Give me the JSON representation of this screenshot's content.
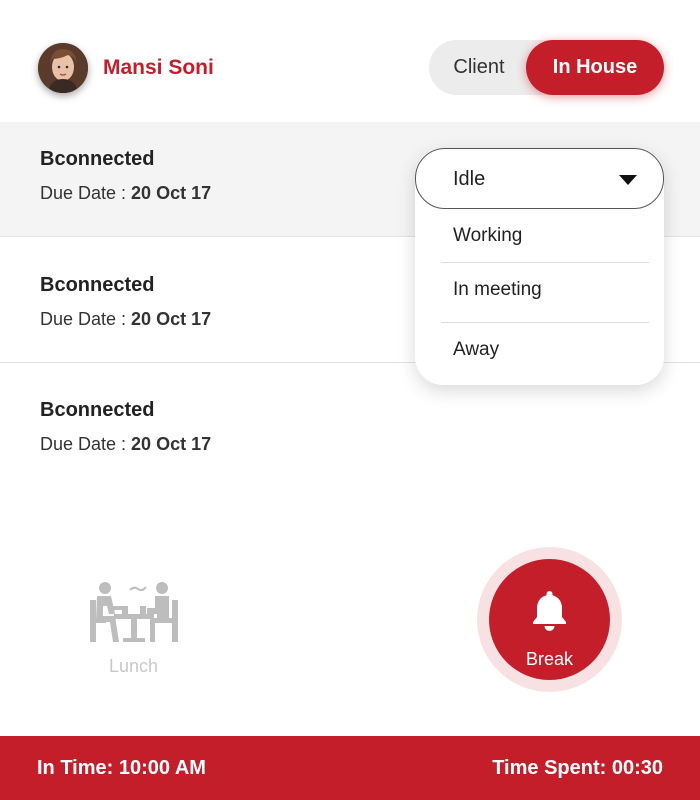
{
  "user": {
    "name": "Mansi Soni"
  },
  "toggle": {
    "client_label": "Client",
    "inhouse_label": "In House",
    "selected": "In House"
  },
  "tasks": [
    {
      "title": "Bconnected",
      "due_label": "Due Date : ",
      "due_value": "20 Oct 17"
    },
    {
      "title": "Bconnected",
      "due_label": "Due Date : ",
      "due_value": "20 Oct 17"
    },
    {
      "title": "Bconnected",
      "due_label": "Due Date : ",
      "due_value": "20 Oct 17"
    }
  ],
  "status_dropdown": {
    "selected": "Idle",
    "options": [
      "Working",
      "In meeting",
      "Away"
    ]
  },
  "actions": {
    "lunch_label": "Lunch",
    "break_label": "Break"
  },
  "footer": {
    "in_time": "In Time: 10:00 AM",
    "time_spent": "Time Spent: 00:30"
  },
  "colors": {
    "accent": "#c41e2b",
    "break_ring": "#f7e1e3",
    "muted": "#c8c8c8"
  },
  "icons": {
    "lunch": "people-dining-icon",
    "break": "bell-icon",
    "dropdown": "caret-down-icon"
  }
}
